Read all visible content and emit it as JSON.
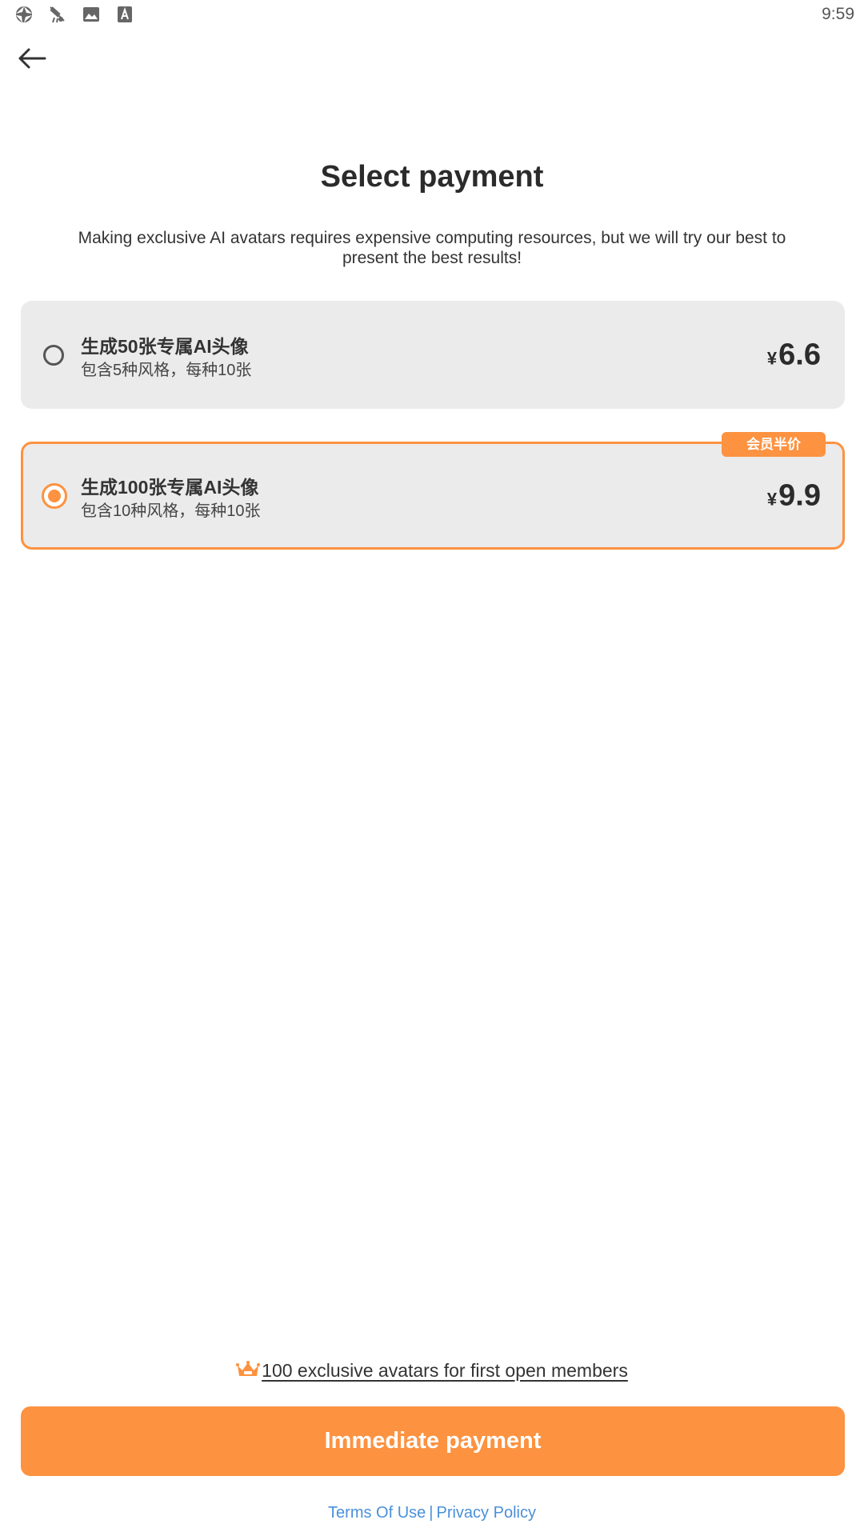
{
  "status_bar": {
    "time": "9:59",
    "icons": [
      "camera-aperture-icon",
      "bird-icon",
      "image-icon",
      "font-a-icon"
    ]
  },
  "header": {
    "back_icon": "arrow-left-icon"
  },
  "main": {
    "title": "Select payment",
    "subtitle": "Making exclusive AI avatars requires expensive computing resources, but we will try our best to present the best results!"
  },
  "plans": [
    {
      "title": "生成50张专属AI头像",
      "description": "包含5种风格，每种10张",
      "currency": "¥",
      "price": "6.6",
      "selected": false
    },
    {
      "title": "生成100张专属AI头像",
      "description": "包含10种风格，每种10张",
      "currency": "¥",
      "price": "9.9",
      "selected": true,
      "badge": "会员半价"
    }
  ],
  "footer": {
    "promo_icon": "crown-icon",
    "promo_text": "100 exclusive avatars for first open members",
    "pay_button_label": "Immediate payment",
    "terms_label": "Terms Of Use",
    "separator": "|",
    "privacy_label": "Privacy Policy"
  },
  "colors": {
    "accent": "#fd9240",
    "card_bg": "#ebebeb",
    "link": "#4a90d9",
    "text": "#2b2b2b"
  }
}
